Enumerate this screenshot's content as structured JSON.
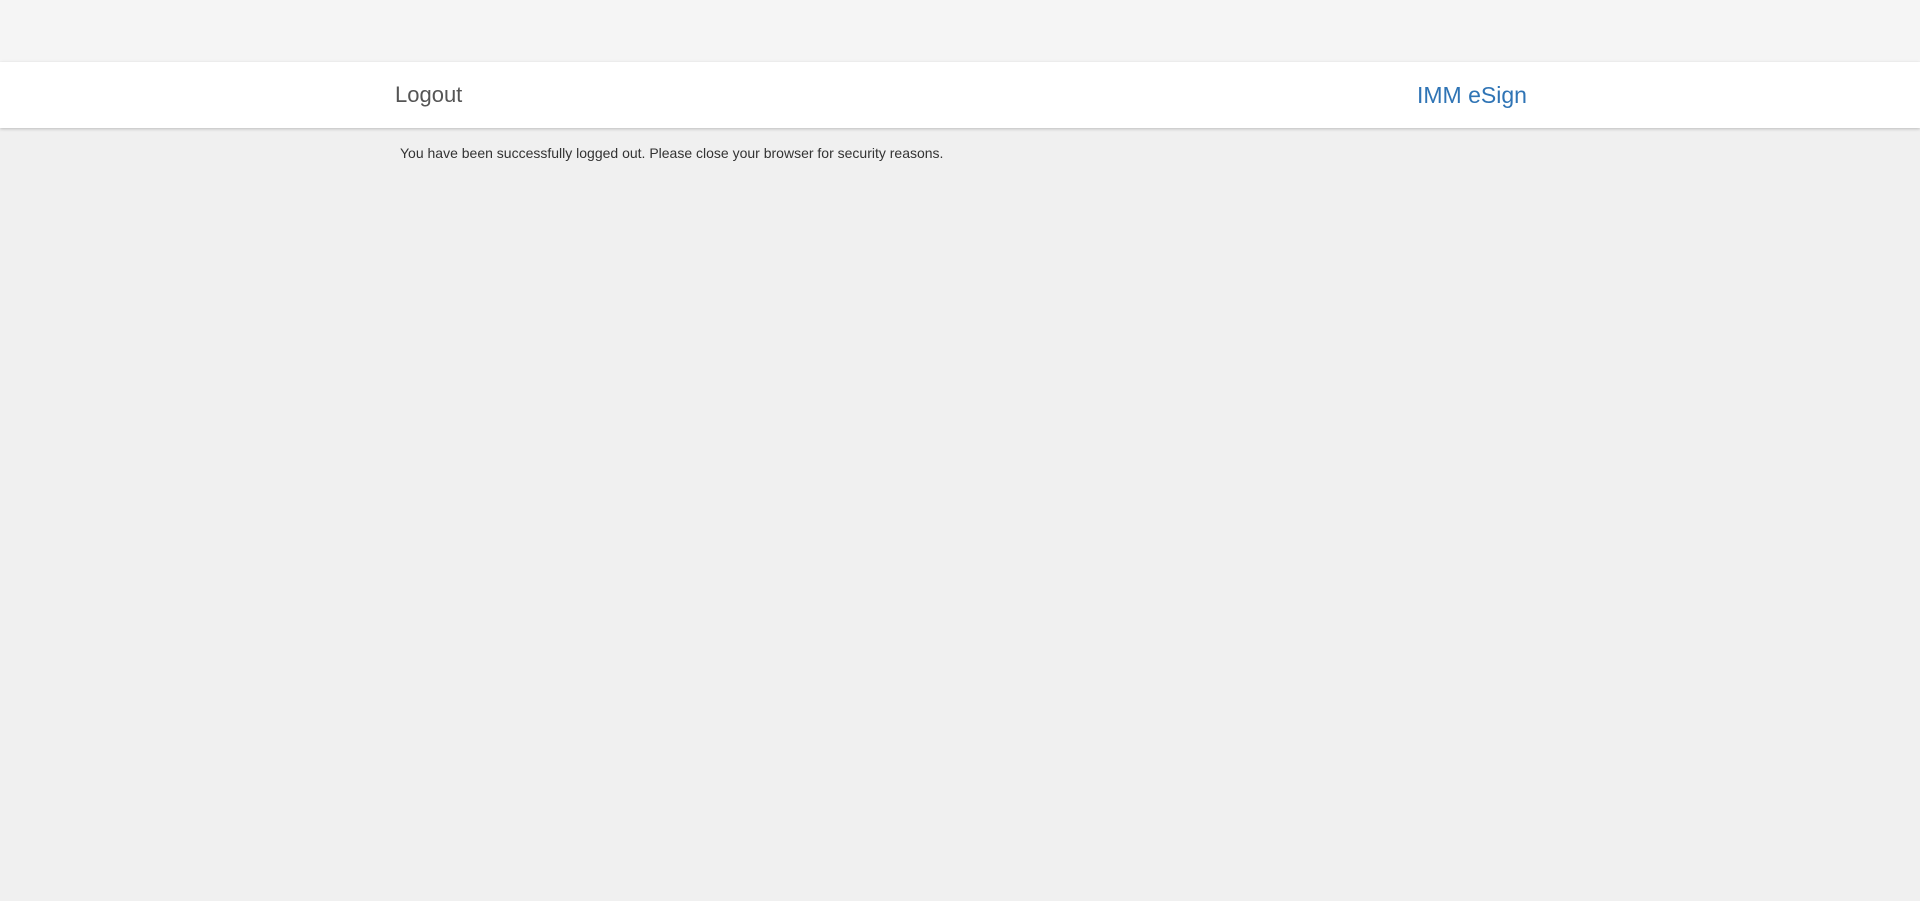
{
  "header": {
    "title": "Logout",
    "app_name": "IMM eSign"
  },
  "main": {
    "message": "You have been successfully logged out. Please close your browser for security reasons."
  },
  "colors": {
    "background": "#f0f0f0",
    "top_strip": "#f5f5f5",
    "header_bg": "#ffffff",
    "title_text": "#555555",
    "brand": "#2f74b5",
    "body_text": "#333333"
  }
}
